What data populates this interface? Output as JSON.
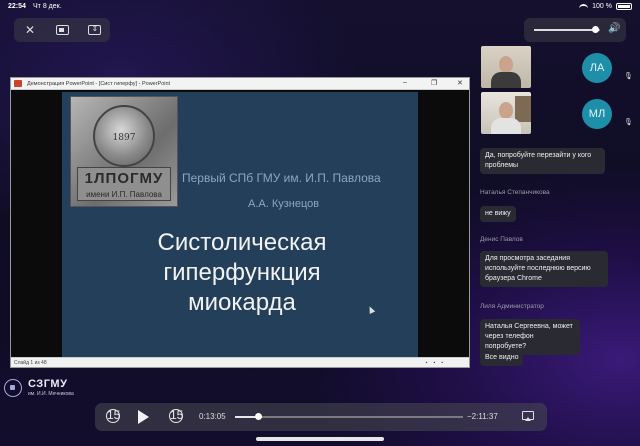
{
  "status_bar": {
    "time": "22:54",
    "date": "Чт 8 дек.",
    "battery": "100 %"
  },
  "window": {
    "title": "Демонстрация PowerPoint - [Сист гиперфу] - PowerPoint"
  },
  "slide": {
    "institution": "Первый СПб ГМУ им. И.П. Павлова",
    "author": "А.А. Кузнецов",
    "topic": "Систолическая гиперфункция миокарда",
    "medal_year": "1897",
    "plaque_line1": "1ЛПОГМУ",
    "plaque_line2": "имени И.П. Павлова",
    "counter": "Слайд 1 из 48"
  },
  "participants": [
    {
      "initials": "ЛА"
    },
    {
      "initials": "МЛ"
    }
  ],
  "chat": [
    {
      "sender": "",
      "text": "Да, попробуйте перезайти у кого проблемы"
    },
    {
      "sender": "Наталья Степанчикова",
      "text": "не вижу"
    },
    {
      "sender": "Денис Павлов",
      "text": "Для просмотра заседания используйте последнюю версию браузера Chrome"
    },
    {
      "sender": "Лиля Администратор",
      "text": "Наталья Сергеевна, может через телефон попробуете?"
    },
    {
      "sender": "",
      "text": "Все видно"
    }
  ],
  "logo": {
    "name": "СЗГМУ",
    "subtitle": "им. И.И. Мечникова"
  },
  "player": {
    "elapsed": "0:13:05",
    "remaining": "−2:11:37",
    "progress": 0.1,
    "skip_back": "15",
    "skip_forward": "15"
  },
  "volume": {
    "level": 0.92
  }
}
